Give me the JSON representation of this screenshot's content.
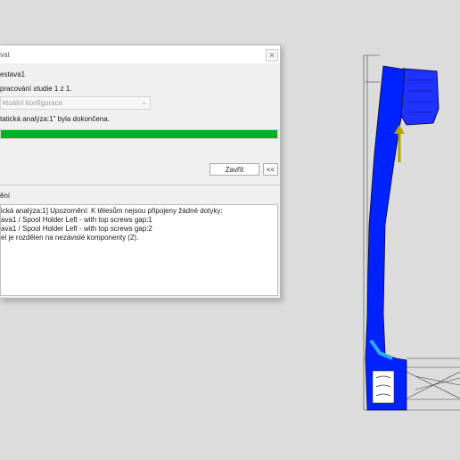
{
  "dialog": {
    "title": "vat",
    "close_glyph": "✕",
    "assembly_name": "estava1",
    "progress_text": "pracování studie 1 z 1.",
    "config_select": {
      "value": "ktuální konfigurace"
    },
    "status_text": "tatická analýza:1\" byla dokončena.",
    "progress": {
      "percent": 100,
      "color": "#06b025"
    },
    "close_button": "Zavřít",
    "collapse_button": "<<",
    "messages_title": "ění",
    "messages": [
      "ická analýza:1] Upozornění: K tělesům nejsou připojeny žádné dotyky:",
      "ava1 / Spool Holder Left - with top screws gap:1",
      "ava1 / Spool Holder Left - with top screws gap:2",
      "el je rozdělen na nezávislé komponenty (2)."
    ]
  },
  "viewport": {
    "model_color": "#0022ff",
    "arrow_color": "#b3a400",
    "icons": [
      "fixture-arrow-icon"
    ]
  }
}
